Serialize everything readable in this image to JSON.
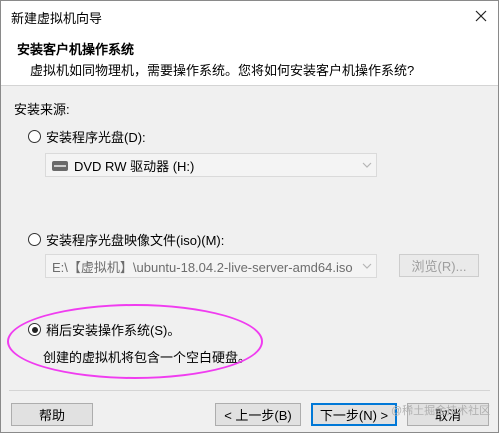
{
  "window": {
    "title": "新建虚拟机向导"
  },
  "header": {
    "title": "安装客户机操作系统",
    "subtitle": "虚拟机如同物理机，需要操作系统。您将如何安装客户机操作系统?"
  },
  "source": {
    "label": "安装来源:",
    "options": [
      {
        "label": "安装程序光盘(D):",
        "selected": false
      },
      {
        "label": "安装程序光盘映像文件(iso)(M):",
        "selected": false
      },
      {
        "label": "稍后安装操作系统(S)。",
        "selected": true
      }
    ],
    "disc_drive": {
      "value": "DVD RW 驱动器 (H:)",
      "icon": "dvd-drive-icon"
    },
    "iso_path": {
      "value": "E:\\【虚拟机】\\ubuntu-18.04.2-live-server-amd64.iso"
    },
    "browse_label": "浏览(R)...",
    "later_description": "创建的虚拟机将包含一个空白硬盘。"
  },
  "footer": {
    "help_label": "帮助",
    "back_label": "< 上一步(B)",
    "next_label": "下一步(N) >",
    "cancel_label": "取消"
  },
  "watermark": "@稀土掘金技术社区",
  "colors": {
    "highlight": "#f03cf0",
    "primary_border": "#0078d7"
  }
}
